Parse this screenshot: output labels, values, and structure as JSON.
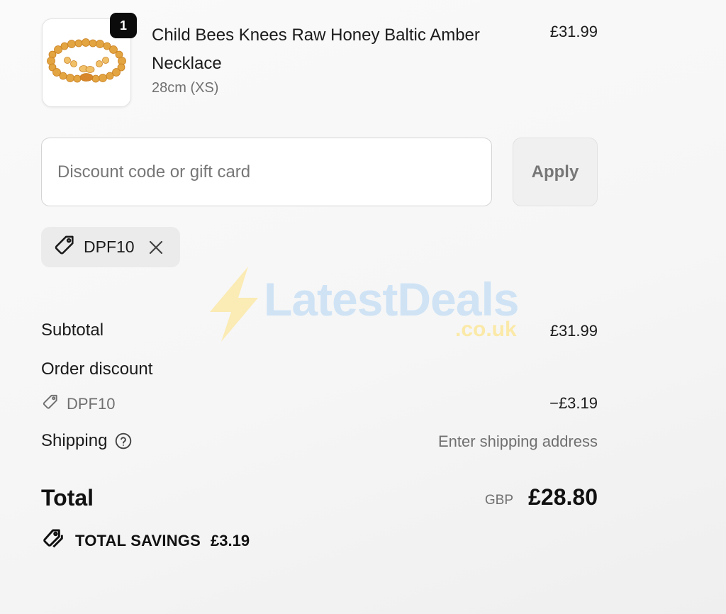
{
  "product": {
    "quantity": "1",
    "name": "Child Bees Knees Raw Honey Baltic Amber Necklace",
    "variant": "28cm (XS)",
    "price": "£31.99"
  },
  "discount": {
    "placeholder": "Discount code or gift card",
    "apply_label": "Apply",
    "applied_code": "DPF10"
  },
  "summary": {
    "subtotal_label": "Subtotal",
    "subtotal_value": "£31.99",
    "order_discount_label": "Order discount",
    "discount_code": "DPF10",
    "discount_value": "−£3.19",
    "shipping_label": "Shipping",
    "shipping_value": "Enter shipping address",
    "total_label": "Total",
    "currency": "GBP",
    "total_value": "£28.80",
    "savings_label": "TOTAL SAVINGS",
    "savings_value": "£3.19"
  },
  "watermark": {
    "brand": "LatestDeals",
    "suffix": ".co.uk"
  },
  "colors": {
    "badge": "#0b0b0b",
    "chip_bg": "#ebebeb",
    "apply_bg": "#f0f0f0",
    "watermark_blue": "#cfe3f5",
    "watermark_yellow": "#fbe9a8"
  }
}
